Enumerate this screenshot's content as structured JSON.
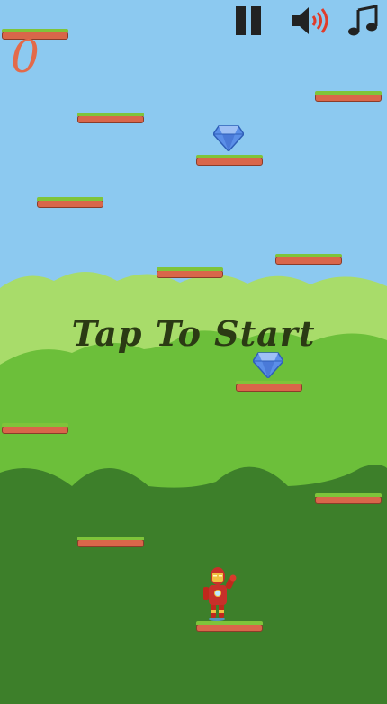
{
  "game": {
    "score": "0",
    "start_prompt": "Tap To Start"
  },
  "hud": {
    "pause_icon": "pause-icon",
    "sound_icon": "speaker-sound-icon",
    "music_icon": "music-note-icon"
  },
  "colors": {
    "sky": "#8cc9f0",
    "hills_light": "#a8dc6a",
    "hills_mid": "#6cbf3a",
    "hills_dark": "#3d7f2a",
    "platform_dirt": "#d9664a",
    "platform_grass": "#7fc43a",
    "score_color": "#e36a4a",
    "prompt_color": "#2b3a14",
    "gem": "#5b8fe8"
  },
  "scene": {
    "platform_count": 12,
    "gem_count": 2,
    "character": "armored-hero"
  }
}
